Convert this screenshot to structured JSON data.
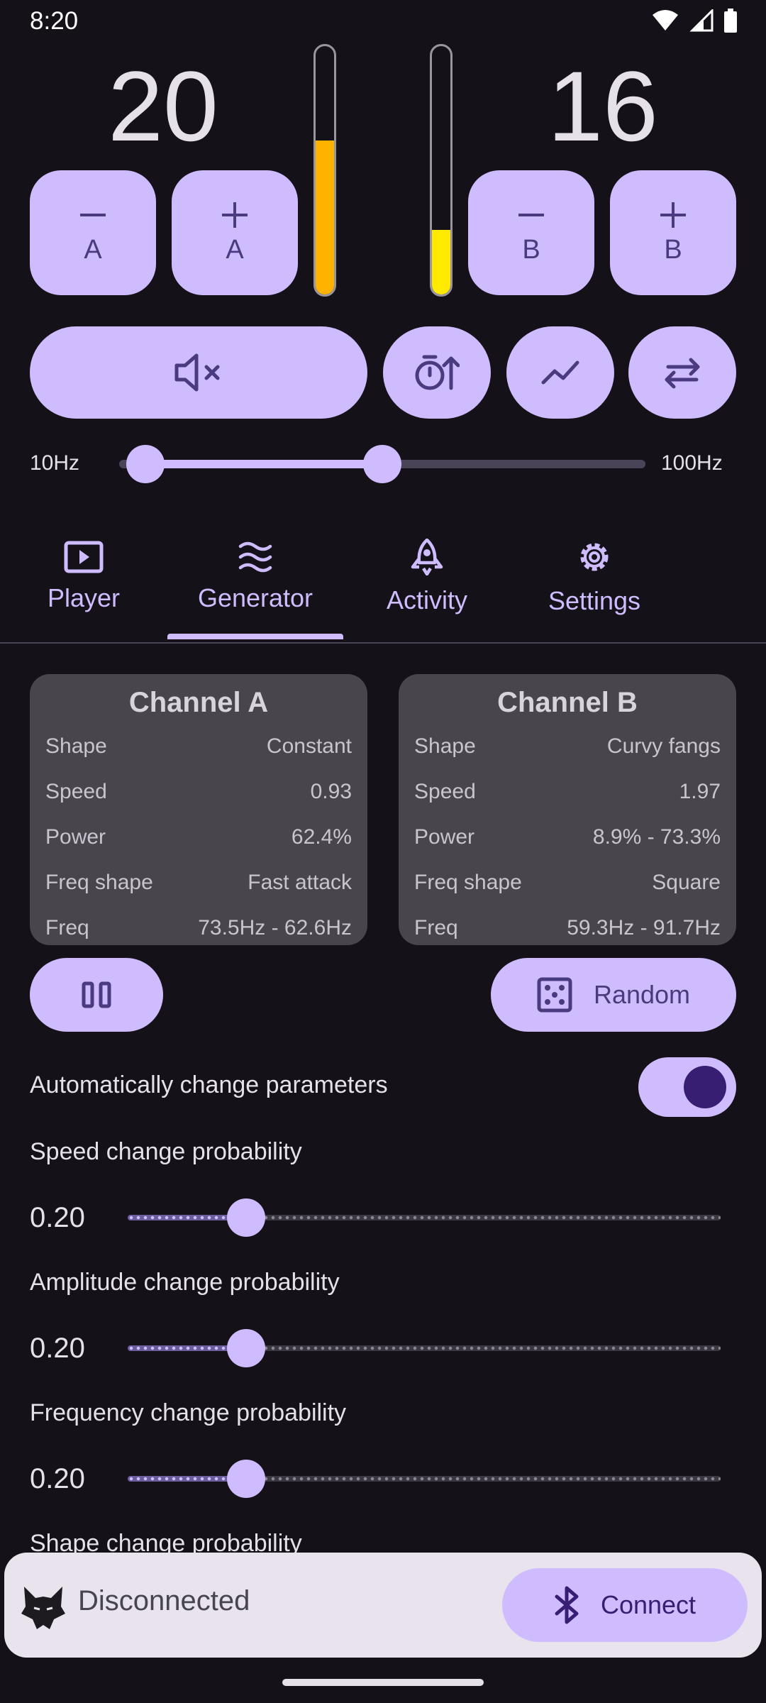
{
  "status": {
    "time": "8:20"
  },
  "channels": {
    "a": {
      "level": "20",
      "meter": 0.62,
      "meter_color": "#ffb300",
      "minus_label": "A",
      "plus_label": "A"
    },
    "b": {
      "level": "16",
      "meter": 0.26,
      "meter_color": "#ffea00",
      "minus_label": "B",
      "plus_label": "B"
    }
  },
  "controls": {
    "icons": [
      "mute-icon",
      "timer-up-icon",
      "chart-line-icon",
      "swap-icon"
    ]
  },
  "freq_range": {
    "min_label": "10Hz",
    "max_label": "100Hz",
    "low_fraction": 0.05,
    "high_fraction": 0.5
  },
  "tabs": [
    {
      "label": "Player",
      "icon": "play-icon"
    },
    {
      "label": "Generator",
      "icon": "waves-icon",
      "selected": true
    },
    {
      "label": "Activity",
      "icon": "rocket-icon"
    },
    {
      "label": "Settings",
      "icon": "gear-icon"
    }
  ],
  "cards": {
    "a": {
      "title": "Channel A",
      "rows": [
        {
          "label": "Shape",
          "value": "Constant"
        },
        {
          "label": "Speed",
          "value": "0.93"
        },
        {
          "label": "Power",
          "value": "62.4%"
        },
        {
          "label": "Freq shape",
          "value": "Fast attack"
        },
        {
          "label": "Freq",
          "value": "73.5Hz - 62.6Hz"
        }
      ]
    },
    "b": {
      "title": "Channel B",
      "rows": [
        {
          "label": "Shape",
          "value": "Curvy fangs"
        },
        {
          "label": "Speed",
          "value": "1.97"
        },
        {
          "label": "Power",
          "value": "8.9% - 73.3%"
        },
        {
          "label": "Freq shape",
          "value": "Square"
        },
        {
          "label": "Freq",
          "value": "59.3Hz - 91.7Hz"
        }
      ]
    }
  },
  "actions": {
    "random_label": "Random"
  },
  "auto_change": {
    "label": "Automatically change parameters",
    "enabled": true
  },
  "sliders": [
    {
      "title": "Speed change probability",
      "value": "0.20",
      "fraction": 0.2
    },
    {
      "title": "Amplitude change probability",
      "value": "0.20",
      "fraction": 0.2
    },
    {
      "title": "Frequency change probability",
      "value": "0.20",
      "fraction": 0.2
    }
  ],
  "partial_setting_title": "Shape change probability",
  "connection": {
    "status": "Disconnected",
    "button_label": "Connect"
  }
}
